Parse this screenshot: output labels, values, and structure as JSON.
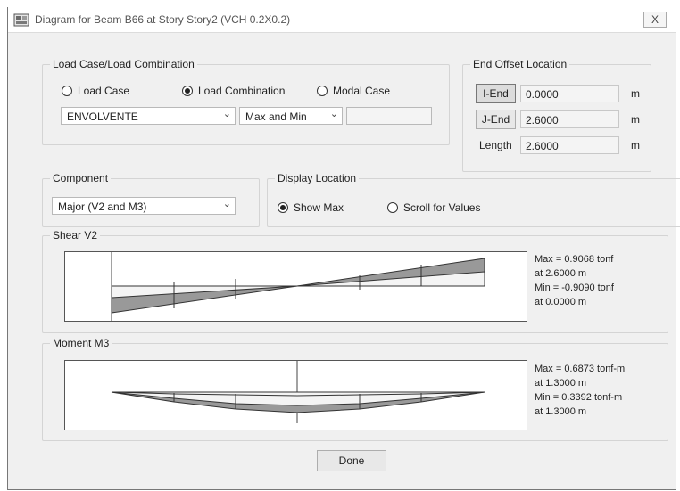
{
  "window": {
    "title": "Diagram for Beam B66 at Story Story2 (VCH 0.2X0.2)",
    "close_label": "X"
  },
  "load_case": {
    "group_title": "Load Case/Load Combination",
    "radios": [
      {
        "label": "Load Case",
        "selected": false
      },
      {
        "label": "Load Combination",
        "selected": true
      },
      {
        "label": "Modal Case",
        "selected": false
      }
    ],
    "combo_value": "ENVOLVENTE",
    "mode_value": "Max and Min",
    "extra_value": ""
  },
  "end_offset": {
    "group_title": "End Offset Location",
    "rows": [
      {
        "button": "I-End",
        "value": "0.0000",
        "unit": "m"
      },
      {
        "button": "J-End",
        "value": "2.6000",
        "unit": "m"
      },
      {
        "label": "Length",
        "value": "2.6000",
        "unit": "m"
      }
    ]
  },
  "component": {
    "group_title": "Component",
    "value": "Major (V2 and M3)"
  },
  "display_location": {
    "group_title": "Display Location",
    "radios": [
      {
        "label": "Show Max",
        "selected": true
      },
      {
        "label": "Scroll for Values",
        "selected": false
      }
    ]
  },
  "shear": {
    "group_title": "Shear V2",
    "info": [
      "Max = 0.9068 tonf",
      "at 2.6000 m",
      "Min = -0.9090 tonf",
      "at 0.0000 m"
    ]
  },
  "moment": {
    "group_title": "Moment M3",
    "info": [
      "Max = 0.6873 tonf-m",
      "at 1.3000 m",
      "Min = 0.3392 tonf-m",
      "at 1.3000 m"
    ]
  },
  "done_label": "Done",
  "colors": {
    "diagram_fill": "#999999",
    "accent": "#222222"
  }
}
